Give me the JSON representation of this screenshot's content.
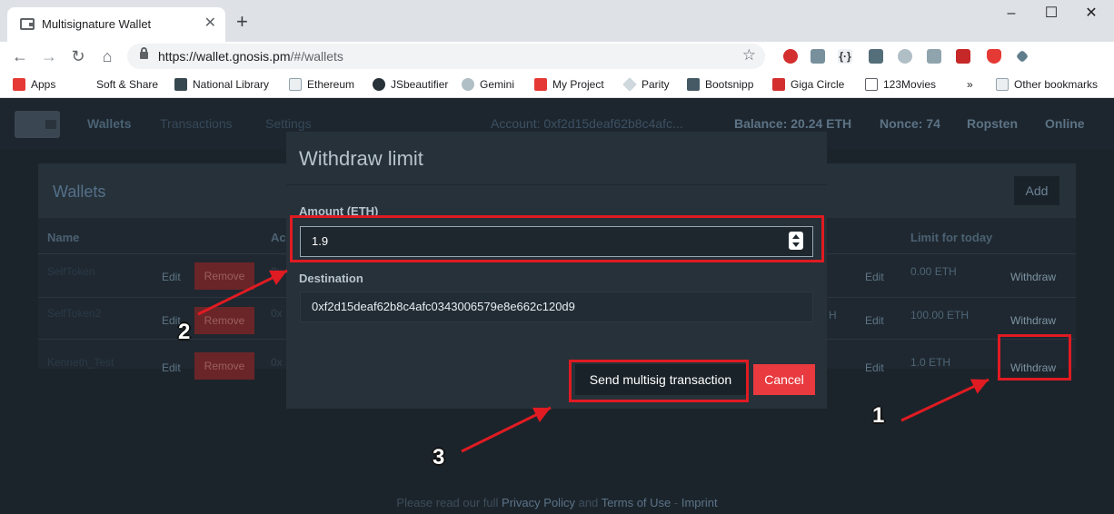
{
  "browser": {
    "tab_title": "Multisignature Wallet",
    "url_main": "https://wallet.gnosis.pm",
    "url_path": "/#/wallets",
    "window_controls": [
      "minimize-icon",
      "maximize-icon",
      "close-icon"
    ],
    "bookmarks": [
      "Apps",
      "Soft & Share",
      "National Library",
      "Ethereum",
      "JSbeautifier",
      "Gemini",
      "My Project",
      "Parity",
      "Bootsnipp",
      "Giga Circle",
      "123Movies",
      "»",
      "Other bookmarks"
    ]
  },
  "nav": {
    "wallets": "Wallets",
    "transactions": "Transactions",
    "settings": "Settings",
    "account": "Account: 0xf2d15deaf62b8c4afc...",
    "balance": "Balance: 20.24 ETH",
    "nonce": "Nonce: 74",
    "network": "Ropsten",
    "status": "Online"
  },
  "wallets_panel": {
    "title": "Wallets",
    "add_label": "Add",
    "headers": {
      "name": "Name",
      "address": "Ac",
      "limit": "Limit for today"
    },
    "rows": [
      {
        "name": "SelfToken",
        "address": "0x",
        "edit": "Edit",
        "remove": "Remove",
        "edit2": "Edit",
        "limit": "0.00 ETH",
        "withdraw": "Withdraw"
      },
      {
        "name": "SelfToken2",
        "address": "0x",
        "edit": "Edit",
        "remove": "Remove",
        "extra": "H",
        "edit2": "Edit",
        "limit": "100.00 ETH",
        "withdraw": "Withdraw"
      },
      {
        "name": "Kenneth_Test",
        "address": "0x",
        "edit": "Edit",
        "remove": "Remove",
        "edit2": "Edit",
        "limit": "1.0 ETH",
        "withdraw": "Withdraw"
      }
    ]
  },
  "modal": {
    "title": "Withdraw limit",
    "amount_label": "Amount (ETH)",
    "amount_value": "1.9",
    "destination_label": "Destination",
    "destination_value": "0xf2d15deaf62b8c4afc0343006579e8e662c120d9",
    "send_label": "Send multisig transaction",
    "cancel_label": "Cancel"
  },
  "footer": {
    "prefix": "Please read our full",
    "privacy": "Privacy Policy",
    "and": "and",
    "terms": "Terms of Use",
    "dash": "-",
    "imprint": "Imprint"
  },
  "annotations": {
    "n1": "1",
    "n2": "2",
    "n3": "3",
    "color": "#e01b22"
  }
}
